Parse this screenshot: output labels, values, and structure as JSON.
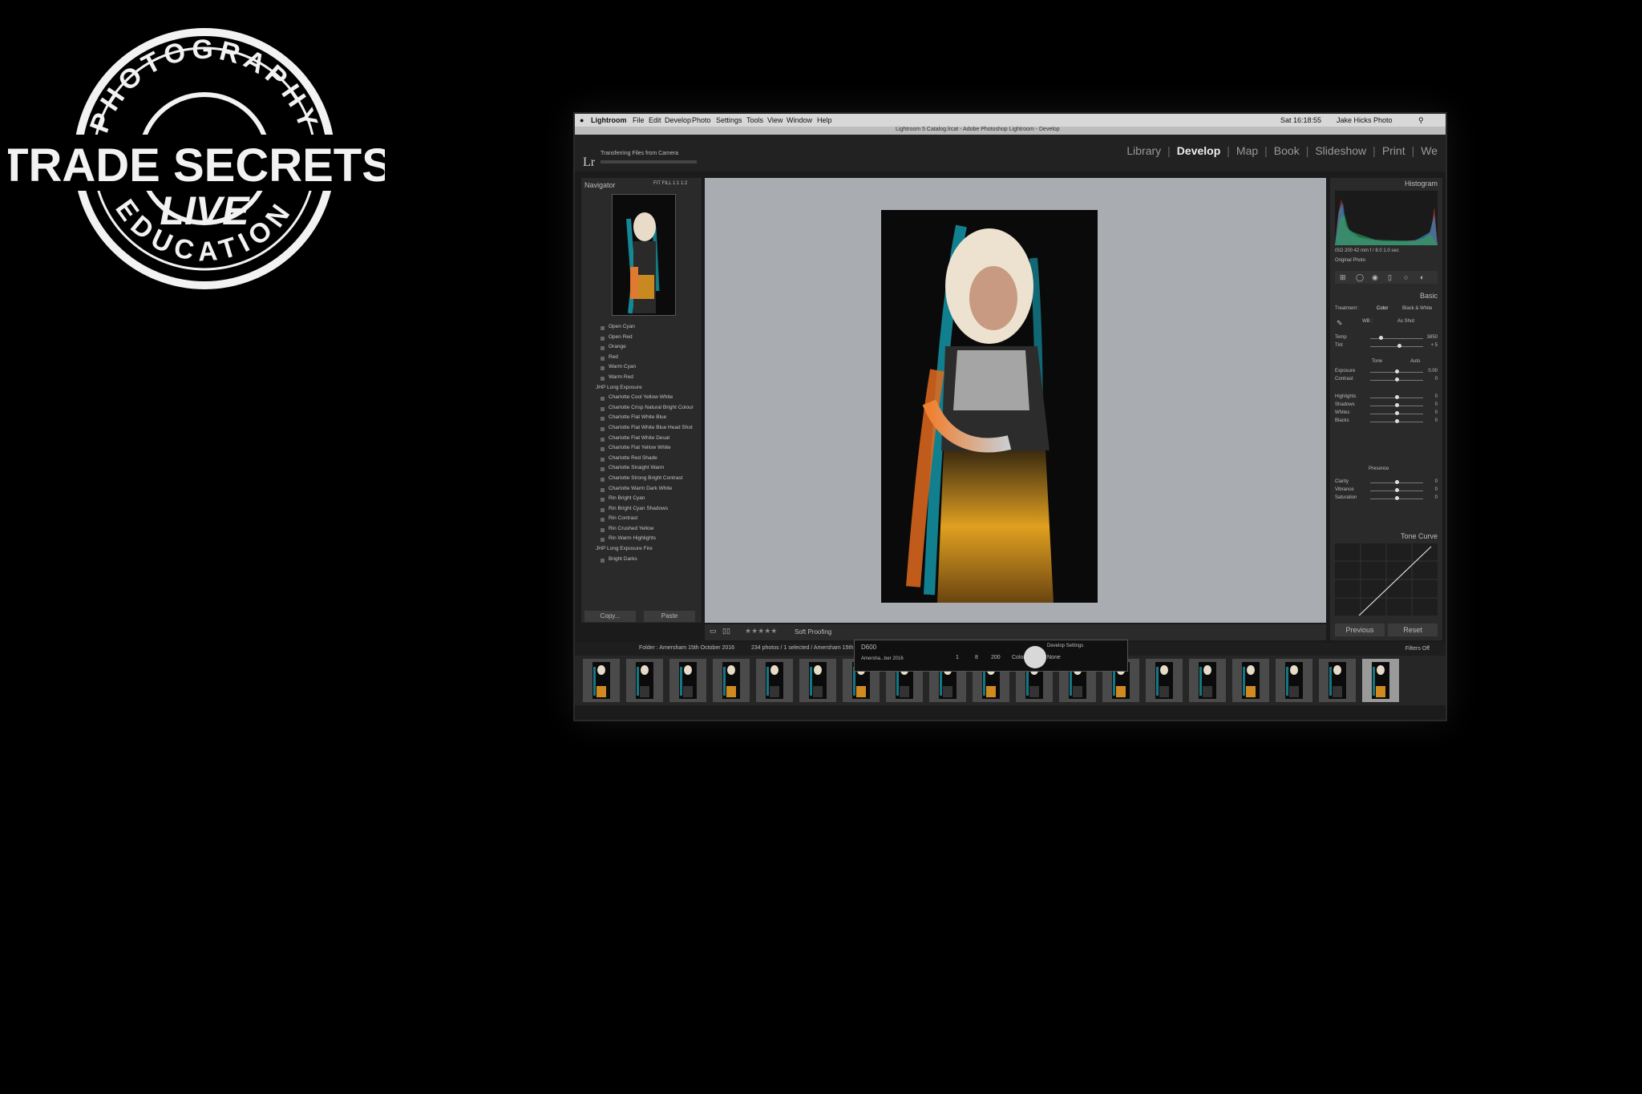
{
  "stamp": {
    "top_text": "PHOTOGRAPHY",
    "main_text": "TRADE SECRETS",
    "sub_text": "LIVE",
    "bottom_text": "EDUCATION"
  },
  "menubar": {
    "app": "Lightroom",
    "items": [
      "File",
      "Edit",
      "Develop",
      "Photo",
      "Settings",
      "Tools",
      "View",
      "Window",
      "Help"
    ],
    "window_title": "Lightroom 5 Catalog.lrcat - Adobe Photoshop Lightroom - Develop",
    "clock": "Sat 16:18:55",
    "user": "Jake Hicks Photo"
  },
  "topbar": {
    "logo": "Lr",
    "transfer_status": "Transferring Files from Camera",
    "modules": [
      "Library",
      "Develop",
      "Map",
      "Book",
      "Slideshow",
      "Print",
      "We"
    ],
    "active_module": "Develop"
  },
  "left_panel": {
    "navigator_title": "Navigator",
    "view_options": "FIT  FILL  1:1  1:2",
    "presets": [
      {
        "label": "Open Cyan",
        "folder": false
      },
      {
        "label": "Open Red",
        "folder": false
      },
      {
        "label": "Orange",
        "folder": false
      },
      {
        "label": "Red",
        "folder": false
      },
      {
        "label": "Warm Cyan",
        "folder": false
      },
      {
        "label": "Warm Red",
        "folder": false
      },
      {
        "label": "JHP Long Exposure",
        "folder": true
      },
      {
        "label": "Charlotte Cool Yellow White",
        "folder": false
      },
      {
        "label": "Charlotte Crisp Natural Bright Colour",
        "folder": false
      },
      {
        "label": "Charlotte Flat White Blue",
        "folder": false
      },
      {
        "label": "Charlotte Flat White Blue Head Shot",
        "folder": false
      },
      {
        "label": "Charlotte Flat White Desat",
        "folder": false
      },
      {
        "label": "Charlotte Flat Yellow White",
        "folder": false
      },
      {
        "label": "Charlotte Red Shade",
        "folder": false
      },
      {
        "label": "Charlotte Straight Warm",
        "folder": false
      },
      {
        "label": "Charlotte Strong Bright Contrast",
        "folder": false
      },
      {
        "label": "Charlotte Warm Dark White",
        "folder": false
      },
      {
        "label": "Rin Bright Cyan",
        "folder": false
      },
      {
        "label": "Rin Bright Cyan Shadows",
        "folder": false
      },
      {
        "label": "Rin Contrast",
        "folder": false
      },
      {
        "label": "Rin Crushed Yellow",
        "folder": false
      },
      {
        "label": "Rin Warm Highlights",
        "folder": false
      },
      {
        "label": "JHP Long Exposure Fire",
        "folder": true
      },
      {
        "label": "Bright Darks",
        "folder": false
      }
    ],
    "copy_label": "Copy...",
    "paste_label": "Paste"
  },
  "toolbar": {
    "soft_proofing": "Soft Proofing"
  },
  "right_panel": {
    "histogram_title": "Histogram",
    "histogram_info": "ISO 200    42 mm    f / 8.0    1.0 sec",
    "original_photo": "Original Photo",
    "basic_title": "Basic",
    "treatment_label": "Treatment :",
    "treatment_color": "Color",
    "treatment_bw": "Black & White",
    "wb_label": "WB :",
    "wb_value": "As Shot",
    "tone_label": "Tone",
    "auto_label": "Auto",
    "presence_label": "Presence",
    "sliders": [
      {
        "label": "Temp",
        "value": "3850",
        "pos": 0.2
      },
      {
        "label": "Tint",
        "value": "+ 5",
        "pos": 0.55
      },
      {
        "label": "Exposure",
        "value": "0.00",
        "pos": 0.5
      },
      {
        "label": "Contrast",
        "value": "0",
        "pos": 0.5
      },
      {
        "label": "Highlights",
        "value": "0",
        "pos": 0.5
      },
      {
        "label": "Shadows",
        "value": "0",
        "pos": 0.5
      },
      {
        "label": "Whites",
        "value": "0",
        "pos": 0.5
      },
      {
        "label": "Blacks",
        "value": "0",
        "pos": 0.5
      },
      {
        "label": "Clarity",
        "value": "0",
        "pos": 0.5
      },
      {
        "label": "Vibrance",
        "value": "0",
        "pos": 0.5
      },
      {
        "label": "Saturation",
        "value": "0",
        "pos": 0.5
      }
    ],
    "tone_curve_title": "Tone Curve",
    "previous_label": "Previous",
    "reset_label": "Reset"
  },
  "filmstrip": {
    "folder_info": "Folder : Amersham 15th October 2016",
    "count_info": "234 photos / 1 selected / Amersham 15th",
    "filters": "Filters Off",
    "thumb_count": 19,
    "selected_index": 18
  },
  "popup": {
    "camera": "D600",
    "filename": "Amersha...ber 2016",
    "shutter": "1",
    "aperture": "8",
    "iso": "200",
    "wb": "Color",
    "develop_settings_label": "Develop Settings",
    "develop_settings_value": "None"
  }
}
